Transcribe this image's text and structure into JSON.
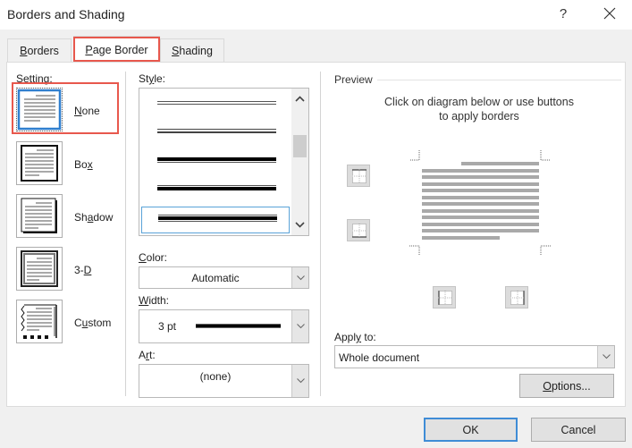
{
  "window": {
    "title": "Borders and Shading",
    "help_label": "?",
    "close_icon": "close-x-icon"
  },
  "tabs": [
    {
      "label": "Borders",
      "mnemonic": "B",
      "rest": "orders",
      "active": false
    },
    {
      "label": "Page Border",
      "mnemonic": "P",
      "rest": "age Border",
      "active": true
    },
    {
      "label": "Shading",
      "mnemonic": "S",
      "rest": "hading",
      "active": false
    }
  ],
  "setting": {
    "label": "Setting:",
    "items": [
      {
        "label": "None",
        "mnemonic": "N",
        "rest": "one",
        "pre": "",
        "icon": "setting-none-icon",
        "selected": true
      },
      {
        "label": "Box",
        "pre": "Bo",
        "mnemonic": "x",
        "rest": "",
        "icon": "setting-box-icon",
        "selected": false
      },
      {
        "label": "Shadow",
        "pre": "Sh",
        "mnemonic": "a",
        "rest": "dow",
        "icon": "setting-shadow-icon",
        "selected": false
      },
      {
        "label": "3-D",
        "pre": "3-",
        "mnemonic": "D",
        "rest": "",
        "icon": "setting-3d-icon",
        "selected": false
      },
      {
        "label": "Custom",
        "pre": "C",
        "mnemonic": "u",
        "rest": "stom",
        "icon": "setting-custom-icon",
        "selected": false
      }
    ]
  },
  "style": {
    "label_pre": "St",
    "label_mnemonic": "y",
    "label_rest": "le:",
    "items": [
      {
        "name": "double-thin",
        "selected": false
      },
      {
        "name": "double-thin-2",
        "selected": false
      },
      {
        "name": "thick-thin",
        "selected": false
      },
      {
        "name": "thin-thick",
        "selected": false
      },
      {
        "name": "thin-thick-thin",
        "selected": true
      }
    ],
    "scroll_up_icon": "chevron-up-icon",
    "scroll_down_icon": "chevron-down-icon"
  },
  "color": {
    "label_mnemonic": "C",
    "label_rest": "olor:",
    "value": "Automatic"
  },
  "width": {
    "label_mnemonic": "W",
    "label_rest": "idth:",
    "value": "3 pt"
  },
  "art": {
    "label_pre": "A",
    "label_mnemonic": "r",
    "label_rest": "t:",
    "value": "(none)"
  },
  "preview": {
    "label": "Preview",
    "caption_line1": "Click on diagram below or use buttons",
    "caption_line2": "to apply borders",
    "buttons": [
      "top-border-button",
      "bottom-border-button",
      "left-border-button",
      "right-border-button"
    ]
  },
  "apply_to": {
    "label_pre": "Appl",
    "label_mnemonic": "y",
    "label_rest": " to:",
    "value": "Whole document"
  },
  "buttons": {
    "options_mnemonic": "O",
    "options_rest": "ptions...",
    "ok": "OK",
    "cancel": "Cancel"
  },
  "colors": {
    "highlight": "#e8584d",
    "focus_blue": "#3f8cd6"
  }
}
